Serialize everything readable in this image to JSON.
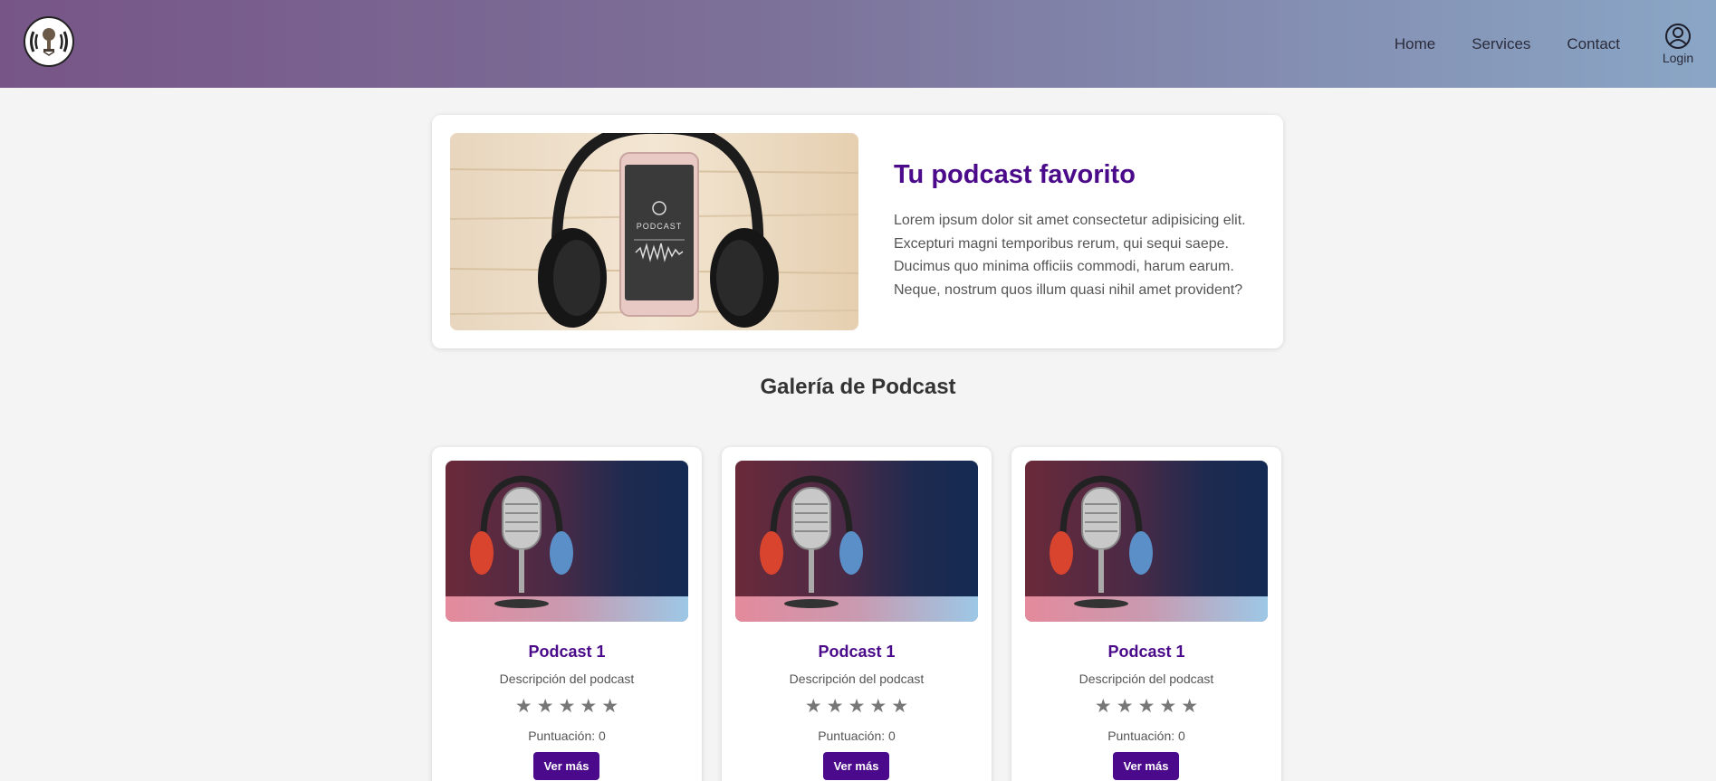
{
  "header": {
    "logo_icon": "microphone-logo-icon",
    "nav": [
      {
        "label": "Home"
      },
      {
        "label": "Services"
      },
      {
        "label": "Contact"
      }
    ],
    "login_label": "Login",
    "login_icon": "user-icon"
  },
  "hero": {
    "title": "Tu podcast favorito",
    "text": "Lorem ipsum dolor sit amet consectetur adipisicing elit. Excepturi magni temporibus rerum, qui sequi saepe. Ducimus quo minima officiis commodi, harum earum. Neque, nostrum quos illum quasi nihil amet provident?",
    "image_phone_text": "PODCAST"
  },
  "gallery": {
    "title": "Galería de Podcast",
    "cards": [
      {
        "title": "Podcast 1",
        "description": "Descripción del podcast",
        "rating": 0,
        "score_label": "Puntuación: 0",
        "button_label": "Ver más"
      },
      {
        "title": "Podcast 1",
        "description": "Descripción del podcast",
        "rating": 0,
        "score_label": "Puntuación: 0",
        "button_label": "Ver más"
      },
      {
        "title": "Podcast 1",
        "description": "Descripción del podcast",
        "rating": 0,
        "score_label": "Puntuación: 0",
        "button_label": "Ver más"
      }
    ]
  },
  "colors": {
    "accent": "#4a0a8a",
    "header_start": "#775587",
    "header_end": "#8aa6c6"
  }
}
